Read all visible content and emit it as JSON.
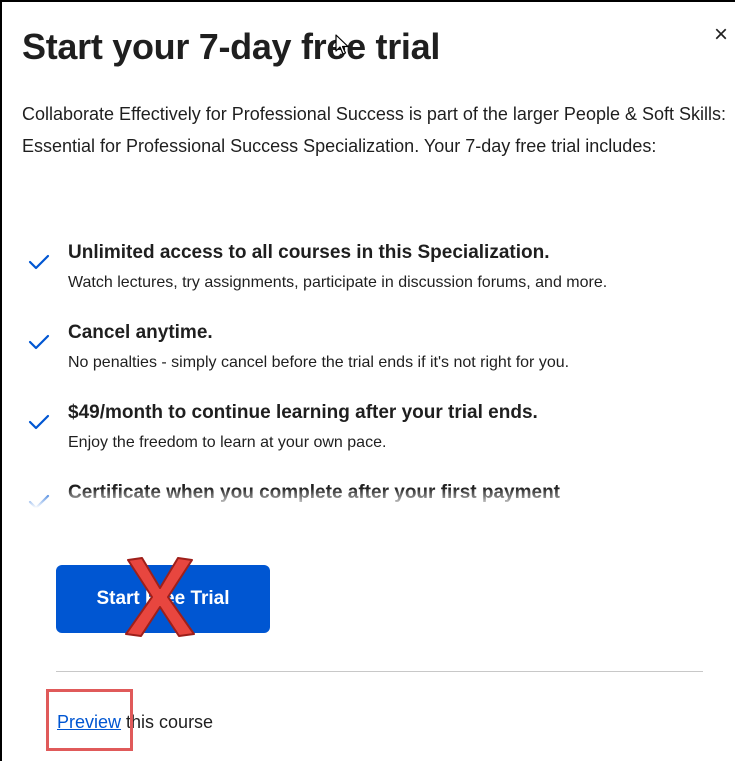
{
  "modal": {
    "title": "Start your 7-day free trial",
    "close_label": "×",
    "intro": "Collaborate Effectively for Professional Success is part of the larger People & Soft Skills: Essential for Professional Success Specialization. Your 7-day free trial includes:",
    "benefits": [
      {
        "title": "Unlimited access to all courses in this Specialization.",
        "description": "Watch lectures, try assignments, participate in discussion forums, and more."
      },
      {
        "title": "Cancel anytime.",
        "description": "No penalties - simply cancel before the trial ends if it's not right for you."
      },
      {
        "title": "$49/month to continue learning after your trial ends.",
        "description": "Enjoy the freedom to learn at your own pace."
      },
      {
        "title": "Certificate when you complete after your first payment",
        "description": ""
      }
    ],
    "cta_label": "Start Free Trial",
    "preview_link": "Preview",
    "preview_suffix": " this course"
  },
  "colors": {
    "primary_blue": "#0056d2",
    "annotation_red": "#e05a5a",
    "text": "#1f1f1f"
  },
  "icons": {
    "close": "close-icon",
    "check": "check-icon",
    "cursor": "mouse-cursor-icon",
    "annotation": "red-x-mark-icon"
  }
}
